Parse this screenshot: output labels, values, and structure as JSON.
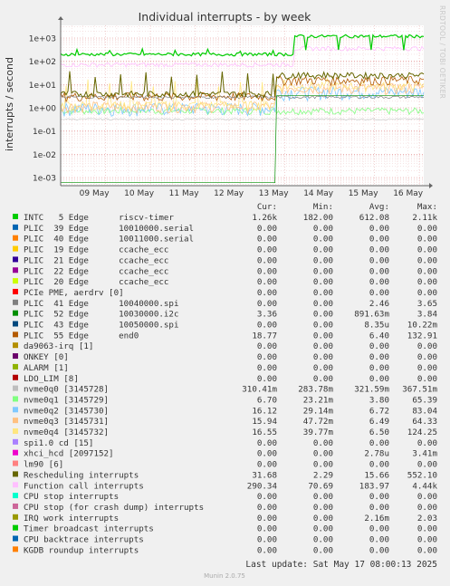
{
  "chart_data": {
    "type": "line",
    "title": "Individual interrupts - by week",
    "ylabel": "interrupts / second",
    "y_scale": "log",
    "ylim": [
      0.0005,
      3000
    ],
    "y_ticks": [
      {
        "value": 1000,
        "label": "1e+03"
      },
      {
        "value": 100,
        "label": "1e+02"
      },
      {
        "value": 10,
        "label": "1e+01"
      },
      {
        "value": 1,
        "label": "1e+00"
      },
      {
        "value": 0.1,
        "label": "1e-01"
      },
      {
        "value": 0.01,
        "label": "1e-02"
      },
      {
        "value": 0.001,
        "label": "1e-03"
      }
    ],
    "x_ticks": [
      "09 May",
      "10 May",
      "11 May",
      "12 May",
      "13 May",
      "14 May",
      "15 May",
      "16 May"
    ],
    "x_range_days": [
      0,
      8.1
    ],
    "grid": true,
    "side_label": "RRDTOOL / TOBI OETIKER",
    "legend_headers": [
      "Cur:",
      "Min:",
      "Avg:",
      "Max:"
    ],
    "series": [
      {
        "name": "INTC   5 Edge      riscv-timer",
        "color": "#00cc00",
        "values": [
          "1.26k",
          "182.00",
          "612.08",
          "2.11k"
        ]
      },
      {
        "name": "PLIC  39 Edge      10010000.serial",
        "color": "#0066b3",
        "values": [
          "0.00",
          "0.00",
          "0.00",
          "0.00"
        ]
      },
      {
        "name": "PLIC  40 Edge      10011000.serial",
        "color": "#ff8000",
        "values": [
          "0.00",
          "0.00",
          "0.00",
          "0.00"
        ]
      },
      {
        "name": "PLIC  19 Edge      ccache_ecc",
        "color": "#ffcc00",
        "values": [
          "0.00",
          "0.00",
          "0.00",
          "0.00"
        ]
      },
      {
        "name": "PLIC  21 Edge      ccache_ecc",
        "color": "#330099",
        "values": [
          "0.00",
          "0.00",
          "0.00",
          "0.00"
        ]
      },
      {
        "name": "PLIC  22 Edge      ccache_ecc",
        "color": "#990099",
        "values": [
          "0.00",
          "0.00",
          "0.00",
          "0.00"
        ]
      },
      {
        "name": "PLIC  20 Edge      ccache_ecc",
        "color": "#ccff00",
        "values": [
          "0.00",
          "0.00",
          "0.00",
          "0.00"
        ]
      },
      {
        "name": "PCIe PME, aerdrv [0]",
        "color": "#ff0000",
        "values": [
          "0.00",
          "0.00",
          "0.00",
          "0.00"
        ]
      },
      {
        "name": "PLIC  41 Edge      10040000.spi",
        "color": "#808080",
        "values": [
          "0.00",
          "0.00",
          "2.46",
          "3.65"
        ]
      },
      {
        "name": "PLIC  52 Edge      10030000.i2c",
        "color": "#008f00",
        "values": [
          "3.36",
          "0.00",
          "891.63m",
          "3.84"
        ]
      },
      {
        "name": "PLIC  43 Edge      10050000.spi",
        "color": "#00487d",
        "values": [
          "0.00",
          "0.00",
          "8.35u",
          "10.22m"
        ]
      },
      {
        "name": "PLIC  55 Edge      end0",
        "color": "#b35a00",
        "values": [
          "18.77",
          "0.00",
          "6.40",
          "132.91"
        ]
      },
      {
        "name": "da9063-irq [1]",
        "color": "#b38f00",
        "values": [
          "0.00",
          "0.00",
          "0.00",
          "0.00"
        ]
      },
      {
        "name": "ONKEY [0]",
        "color": "#6b006b",
        "values": [
          "0.00",
          "0.00",
          "0.00",
          "0.00"
        ]
      },
      {
        "name": "ALARM [1]",
        "color": "#8fb300",
        "values": [
          "0.00",
          "0.00",
          "0.00",
          "0.00"
        ]
      },
      {
        "name": "LDO_LIM [8]",
        "color": "#b30000",
        "values": [
          "0.00",
          "0.00",
          "0.00",
          "0.00"
        ]
      },
      {
        "name": "nvme0q0 [3145728]",
        "color": "#bebebe",
        "values": [
          "310.41m",
          "283.78m",
          "321.59m",
          "367.51m"
        ]
      },
      {
        "name": "nvme0q1 [3145729]",
        "color": "#80ff80",
        "values": [
          "6.70",
          "23.21m",
          "3.80",
          "65.39"
        ]
      },
      {
        "name": "nvme0q2 [3145730]",
        "color": "#80c9ff",
        "values": [
          "16.12",
          "29.14m",
          "6.72",
          "83.04"
        ]
      },
      {
        "name": "nvme0q3 [3145731]",
        "color": "#ffc080",
        "values": [
          "15.94",
          "47.72m",
          "6.49",
          "64.33"
        ]
      },
      {
        "name": "nvme0q4 [3145732]",
        "color": "#ffe680",
        "values": [
          "16.55",
          "39.77m",
          "6.50",
          "124.25"
        ]
      },
      {
        "name": "spi1.0 cd [15]",
        "color": "#aa80ff",
        "values": [
          "0.00",
          "0.00",
          "0.00",
          "0.00"
        ]
      },
      {
        "name": "xhci_hcd [2097152]",
        "color": "#ee00cc",
        "values": [
          "0.00",
          "0.00",
          "2.78u",
          "3.41m"
        ]
      },
      {
        "name": "lm90 [6]",
        "color": "#ff8080",
        "values": [
          "0.00",
          "0.00",
          "0.00",
          "0.00"
        ]
      },
      {
        "name": "Rescheduling interrupts",
        "color": "#666600",
        "values": [
          "31.68",
          "2.29",
          "15.66",
          "552.10"
        ]
      },
      {
        "name": "Function call interrupts",
        "color": "#ffbfff",
        "values": [
          "290.34",
          "70.69",
          "183.97",
          "4.44k"
        ]
      },
      {
        "name": "CPU stop interrupts",
        "color": "#00ffcc",
        "values": [
          "0.00",
          "0.00",
          "0.00",
          "0.00"
        ]
      },
      {
        "name": "CPU stop (for crash dump) interrupts",
        "color": "#cc6699",
        "values": [
          "0.00",
          "0.00",
          "0.00",
          "0.00"
        ]
      },
      {
        "name": "IRQ work interrupts",
        "color": "#999900",
        "values": [
          "0.00",
          "0.00",
          "2.16m",
          "2.03"
        ]
      },
      {
        "name": "Timer broadcast interrupts",
        "color": "#00cc00",
        "values": [
          "0.00",
          "0.00",
          "0.00",
          "0.00"
        ]
      },
      {
        "name": "CPU backtrace interrupts",
        "color": "#0066b3",
        "values": [
          "0.00",
          "0.00",
          "0.00",
          "0.00"
        ]
      },
      {
        "name": "KGDB roundup interrupts",
        "color": "#ff8000",
        "values": [
          "0.00",
          "0.00",
          "0.00",
          "0.00"
        ]
      }
    ],
    "last_update": "Last update: Sat May 17 08:00:13 2025",
    "footer": "Munin 2.0.75"
  }
}
